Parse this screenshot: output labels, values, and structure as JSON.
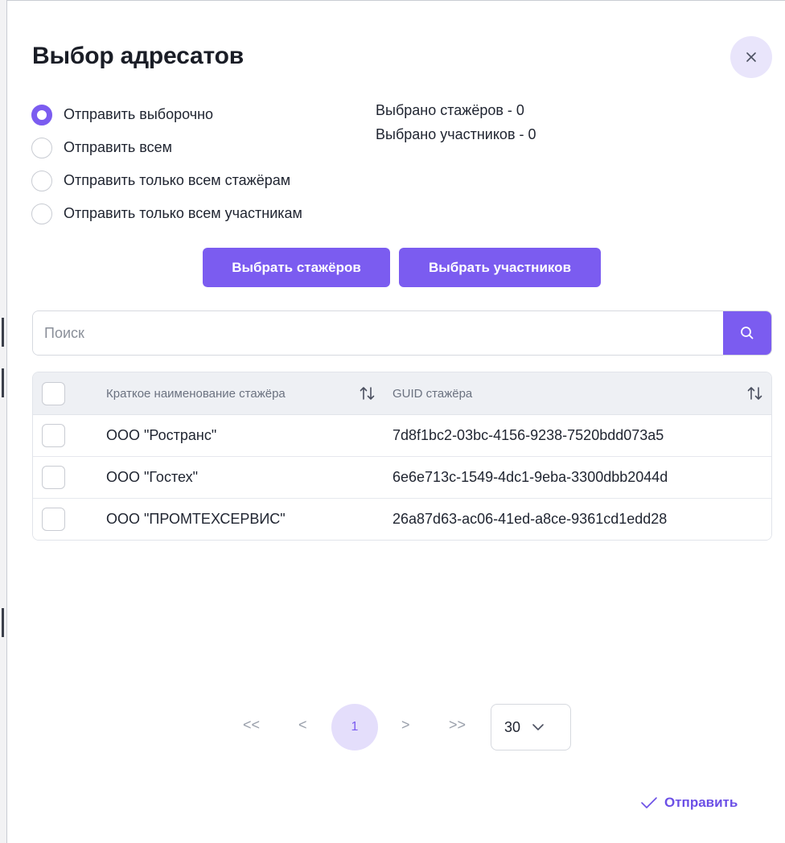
{
  "dialog": {
    "title": "Выбор адресатов"
  },
  "send_mode": {
    "selected_index": 0,
    "options": [
      {
        "label": "Отправить выборочно"
      },
      {
        "label": "Отправить всем"
      },
      {
        "label": "Отправить только всем стажёрам"
      },
      {
        "label": "Отправить только всем участникам"
      }
    ]
  },
  "counters": {
    "trainees": "Выбрано стажёров - 0",
    "participants": "Выбрано участников - 0"
  },
  "actions": {
    "select_trainees": "Выбрать стажёров",
    "select_participants": "Выбрать участников"
  },
  "search": {
    "placeholder": "Поиск",
    "value": ""
  },
  "table": {
    "columns": [
      {
        "label": "Краткое наименование стажёра"
      },
      {
        "label": "GUID стажёра"
      }
    ],
    "rows": [
      {
        "name": "ООО \"Ространс\"",
        "guid": "7d8f1bc2-03bc-4156-9238-7520bdd073a5"
      },
      {
        "name": "ООО \"Гостех\"",
        "guid": "6e6e713c-1549-4dc1-9eba-3300dbb2044d"
      },
      {
        "name": "ООО \"ПРОМТЕХСЕРВИС\"",
        "guid": "26a87d63-ac06-41ed-a8ce-9361cd1edd28"
      }
    ]
  },
  "pagination": {
    "first": "<<",
    "prev": "<",
    "current_page": "1",
    "next": ">",
    "last": ">>",
    "page_size": "30"
  },
  "footer": {
    "submit_label": "Отправить"
  },
  "colors": {
    "accent": "#7b5cf0",
    "accent_light": "#e9e5fb"
  }
}
